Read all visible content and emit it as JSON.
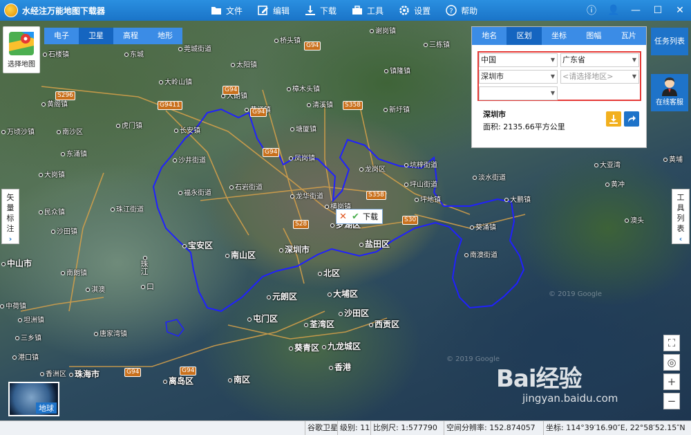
{
  "app": {
    "title": "水经注万能地图下载器"
  },
  "menu": [
    {
      "label": "文件",
      "icon": "folder-icon"
    },
    {
      "label": "编辑",
      "icon": "edit-icon"
    },
    {
      "label": "下载",
      "icon": "download-icon"
    },
    {
      "label": "工具",
      "icon": "toolbox-icon"
    },
    {
      "label": "设置",
      "icon": "gear-icon"
    },
    {
      "label": "帮助",
      "icon": "help-icon"
    }
  ],
  "map_select": {
    "label": "选择地图"
  },
  "map_types": [
    {
      "label": "电子",
      "active": false
    },
    {
      "label": "卫星",
      "active": true
    },
    {
      "label": "高程",
      "active": false
    },
    {
      "label": "地形",
      "active": false
    }
  ],
  "left_tab": {
    "label_lines": [
      "矢",
      "量",
      "标",
      "注"
    ]
  },
  "right_tab": {
    "label_lines": [
      "工",
      "具",
      "列",
      "表"
    ]
  },
  "panel": {
    "tabs": [
      {
        "label": "地名",
        "active": false
      },
      {
        "label": "区划",
        "active": true
      },
      {
        "label": "坐标",
        "active": false
      },
      {
        "label": "图幅",
        "active": false
      },
      {
        "label": "瓦片",
        "active": false
      }
    ],
    "country": "中国",
    "province": "广东省",
    "city": "深圳市",
    "district_placeholder": "<请选择地区>",
    "sub_district": "",
    "result_name": "深圳市",
    "result_area": "面积: 2135.66平方公里"
  },
  "task_list": {
    "label": "任务列表"
  },
  "online_service": {
    "label": "在线客服"
  },
  "download_popup": {
    "label": "下载"
  },
  "globe": {
    "label": "地球"
  },
  "watermark": {
    "logo": "Bai经验",
    "url": "jingyan.baidu.com"
  },
  "google_marks": [
    "© 2019 Google",
    "© 2019 Google"
  ],
  "places": [
    {
      "name": "石楼镇",
      "type": "town"
    },
    {
      "name": "莞城街道",
      "type": "town"
    },
    {
      "name": "桥头镇",
      "type": "town"
    },
    {
      "name": "谢岗镇",
      "type": "town"
    },
    {
      "name": "太阳镇",
      "type": "town"
    },
    {
      "name": "大岭山镇",
      "type": "town"
    },
    {
      "name": "大朗镇",
      "type": "town"
    },
    {
      "name": "黄江镇",
      "type": "town"
    },
    {
      "name": "樟木头镇",
      "type": "town"
    },
    {
      "name": "清溪镇",
      "type": "town"
    },
    {
      "name": "塘厦镇",
      "type": "town"
    },
    {
      "name": "凤岗镇",
      "type": "town"
    },
    {
      "name": "新圩镇",
      "type": "town"
    },
    {
      "name": "镇隆镇",
      "type": "town"
    },
    {
      "name": "三栋镇",
      "type": "town"
    },
    {
      "name": "虎门镇",
      "type": "town"
    },
    {
      "name": "长安镇",
      "type": "town"
    },
    {
      "name": "沙井街道",
      "type": "town"
    },
    {
      "name": "福永街道",
      "type": "town"
    },
    {
      "name": "石岩街道",
      "type": "town"
    },
    {
      "name": "龙华街道",
      "type": "town"
    },
    {
      "name": "龙岗区",
      "type": "town"
    },
    {
      "name": "坑梓街道",
      "type": "town"
    },
    {
      "name": "坪山街道",
      "type": "town"
    },
    {
      "name": "淡水街道",
      "type": "town"
    },
    {
      "name": "大亚湾",
      "type": "town"
    },
    {
      "name": "宝安区",
      "type": "district"
    },
    {
      "name": "南山区",
      "type": "district"
    },
    {
      "name": "深圳市",
      "type": "city"
    },
    {
      "name": "罗湖区",
      "type": "district"
    },
    {
      "name": "盐田区",
      "type": "district"
    },
    {
      "name": "南澳街道",
      "type": "town"
    },
    {
      "name": "北区",
      "type": "district"
    },
    {
      "name": "大埔区",
      "type": "district"
    },
    {
      "name": "元朗区",
      "type": "district"
    },
    {
      "name": "屯门区",
      "type": "district"
    },
    {
      "name": "荃湾区",
      "type": "district"
    },
    {
      "name": "沙田区",
      "type": "district"
    },
    {
      "name": "西贡区",
      "type": "district"
    },
    {
      "name": "葵青区",
      "type": "district"
    },
    {
      "name": "九龙城区",
      "type": "district"
    },
    {
      "name": "香港",
      "type": "city"
    },
    {
      "name": "离岛区",
      "type": "district"
    },
    {
      "name": "南区",
      "type": "district"
    },
    {
      "name": "中山市",
      "type": "city"
    },
    {
      "name": "珠海市",
      "type": "city"
    },
    {
      "name": "香洲区",
      "type": "district"
    },
    {
      "name": "南朗镇",
      "type": "town"
    },
    {
      "name": "民众镇",
      "type": "town"
    },
    {
      "name": "南沙区",
      "type": "district"
    },
    {
      "name": "珠江街道",
      "type": "town"
    },
    {
      "name": "万顷沙镇",
      "type": "town"
    },
    {
      "name": "黄阁镇",
      "type": "town"
    },
    {
      "name": "大岗镇",
      "type": "town"
    },
    {
      "name": "东涌镇",
      "type": "town"
    },
    {
      "name": "三乡镇",
      "type": "town"
    },
    {
      "name": "唐家湾镇",
      "type": "town"
    },
    {
      "name": "坦洲镇",
      "type": "town"
    },
    {
      "name": "淇澳",
      "type": "town"
    },
    {
      "name": "中荷镇",
      "type": "town"
    },
    {
      "name": "港口镇",
      "type": "town"
    },
    {
      "name": "黄冲",
      "type": "town"
    },
    {
      "name": "澳头",
      "type": "town"
    },
    {
      "name": "黄埔",
      "type": "town"
    },
    {
      "name": "沙田镇",
      "type": "town"
    },
    {
      "name": "东城",
      "type": "town"
    },
    {
      "name": "大鹏镇",
      "type": "town"
    },
    {
      "name": "葵涌镇",
      "type": "town"
    },
    {
      "name": "坪地镇",
      "type": "town"
    },
    {
      "name": "横岗镇",
      "type": "town"
    }
  ],
  "highways": [
    "S296",
    "G9411",
    "G94",
    "G94",
    "S358",
    "G94",
    "S358",
    "S30",
    "S28",
    "G94",
    "G94",
    "G94"
  ],
  "road_labels": [
    "珠江",
    "口"
  ],
  "statusbar": {
    "source": "谷歌卫星",
    "level": "级别: 11",
    "scale": "比例尺: 1:577790",
    "resolution": "空间分辨率: 152.874057",
    "coords": "坐标: 114°39′16.90″E, 22°58′52.15″N"
  }
}
